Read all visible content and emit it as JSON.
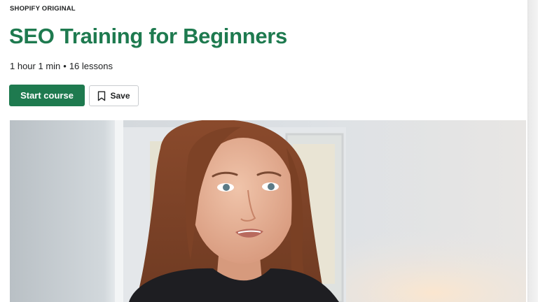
{
  "course": {
    "eyebrow": "SHOPIFY ORIGINAL",
    "title": "SEO Training for Beginners",
    "duration": "1 hour 1 min",
    "separator": "•",
    "lessons": "16 lessons"
  },
  "actions": {
    "start_label": "Start course",
    "save_label": "Save"
  },
  "hero": {
    "description": "Instructor speaking in front of a computer monitor"
  },
  "colors": {
    "brand_green": "#1e7a4f",
    "text": "#202223"
  },
  "icons": {
    "save": "bookmark-icon"
  }
}
